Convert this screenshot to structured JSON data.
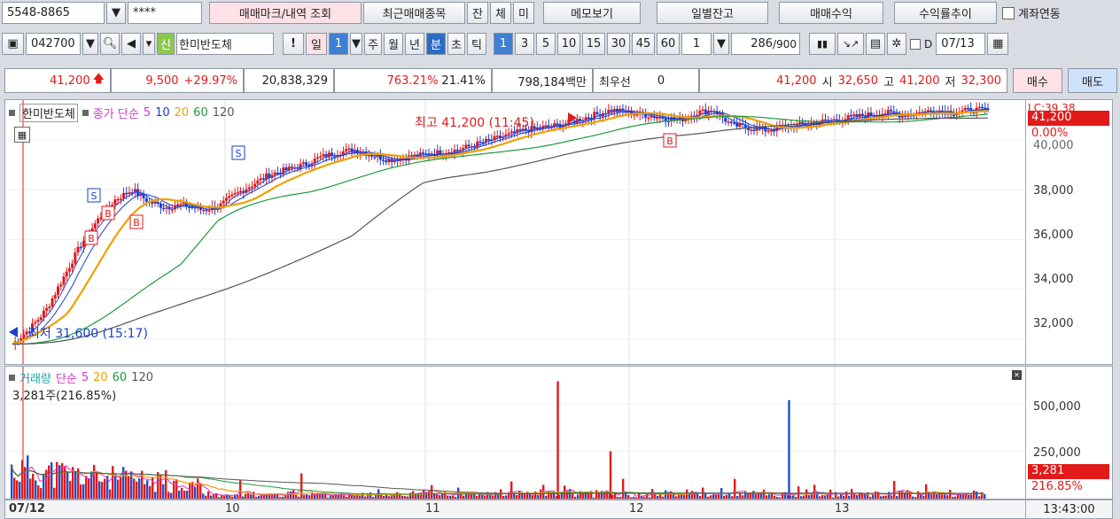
{
  "row1": {
    "account": "5548-8865",
    "password": "****",
    "buttons": [
      "매매마크/내역 조회",
      "최근매매종목",
      "잔",
      "체",
      "미",
      "메모보기",
      "일별잔고",
      "매매수익",
      "수익률추이"
    ],
    "link_label": "계좌연동"
  },
  "row2": {
    "code": "042700",
    "badge": "신",
    "stock_name": "한미반도체",
    "period_buttons": [
      "일",
      "1",
      "주",
      "월",
      "년",
      "분",
      "초",
      "틱"
    ],
    "interval_buttons": [
      "1",
      "3",
      "5",
      "10",
      "15",
      "30",
      "45",
      "60"
    ],
    "multiplier": "1",
    "count": "286",
    "count_max": "/900",
    "date_label": "D",
    "date": "07/13"
  },
  "quote": {
    "price": "41,200",
    "change": "9,500",
    "change_pct": "+29.97%",
    "volume": "20,838,329",
    "vol_ratio": "763.21%",
    "turnover": "21.41%",
    "amount": "798,184백만",
    "best_label": "최우선",
    "best_value": "0",
    "price2": "41,200",
    "open_label": "시",
    "open": "32,650",
    "high_label": "고",
    "high": "41,200",
    "low_label": "저",
    "low": "32,300",
    "buy_label": "매수",
    "sell_label": "매도"
  },
  "price_pane": {
    "legend_name": "한미반도체",
    "legend_series": "종가 단순",
    "ma": [
      "5",
      "10",
      "20",
      "60",
      "120"
    ],
    "high_note": "최고 41,200 (11:45)",
    "low_note": "최저 31,600 (15:17)",
    "current_price": "41,200",
    "current_pct": "0.00%",
    "lc_label": "LC:39.38",
    "marker_s": "S",
    "marker_b": "B"
  },
  "vol_pane": {
    "legend_name": "거래량",
    "legend_series": "단순",
    "ma": [
      "5",
      "20",
      "60",
      "120"
    ],
    "info": "3,281주(216.85%)",
    "current_vol": "3,281",
    "current_pct": "216.85%"
  },
  "time_axis": {
    "labels": [
      "07/12",
      "10",
      "11",
      "12",
      "13"
    ],
    "clock": "13:43:00"
  },
  "chart_data": {
    "type": "candlestick",
    "title": "",
    "xlabel": "",
    "ylabel": "",
    "ylim": [
      31000,
      41600
    ],
    "y_ticks": [
      "32,000",
      "34,000",
      "36,000",
      "38,000"
    ],
    "y_partial_tick": "40,000",
    "vol_ticks": [
      "500,000",
      "250,000"
    ],
    "x_labels": [
      "07/12",
      "10",
      "11",
      "12",
      "13"
    ],
    "close_path": [
      [
        0,
        31800
      ],
      [
        1,
        32400
      ],
      [
        2,
        33200
      ],
      [
        3,
        34500
      ],
      [
        4,
        35800
      ],
      [
        5,
        36800
      ],
      [
        6,
        37600
      ],
      [
        7,
        38000
      ],
      [
        8,
        37500
      ],
      [
        9,
        37300
      ],
      [
        10,
        37400
      ],
      [
        11,
        37200
      ],
      [
        12,
        37300
      ],
      [
        13,
        37800
      ],
      [
        14,
        38200
      ],
      [
        15,
        38600
      ],
      [
        16,
        38800
      ],
      [
        17,
        39000
      ],
      [
        18,
        39300
      ],
      [
        19,
        39500
      ],
      [
        20,
        39600
      ],
      [
        21,
        39400
      ],
      [
        22,
        39200
      ],
      [
        23,
        39300
      ],
      [
        24,
        39400
      ],
      [
        25,
        39500
      ],
      [
        26,
        39600
      ],
      [
        27,
        39800
      ],
      [
        28,
        40000
      ],
      [
        29,
        40200
      ],
      [
        30,
        40400
      ],
      [
        31,
        40500
      ],
      [
        32,
        40600
      ],
      [
        33,
        40800
      ],
      [
        34,
        41000
      ],
      [
        35,
        41200
      ],
      [
        36,
        41100
      ],
      [
        37,
        41000
      ],
      [
        38,
        40900
      ],
      [
        39,
        40800
      ],
      [
        40,
        41100
      ],
      [
        41,
        41200
      ],
      [
        42,
        40600
      ],
      [
        43,
        40500
      ],
      [
        44,
        40400
      ],
      [
        45,
        40500
      ],
      [
        46,
        40600
      ],
      [
        47,
        40700
      ],
      [
        48,
        40800
      ],
      [
        49,
        40900
      ],
      [
        50,
        41000
      ],
      [
        51,
        41100
      ],
      [
        52,
        41000
      ],
      [
        53,
        41100
      ],
      [
        54,
        41200
      ],
      [
        55,
        41100
      ],
      [
        56,
        41200
      ],
      [
        57,
        41200
      ]
    ],
    "series": [
      {
        "name": "5",
        "color": "#2a48d6"
      },
      {
        "name": "10",
        "color": "#1a3fcc"
      },
      {
        "name": "20",
        "color": "#f0a000"
      },
      {
        "name": "60",
        "color": "#1f9a3a"
      },
      {
        "name": "120",
        "color": "#555555"
      }
    ],
    "volume_spikes": [
      {
        "x_frac": 0.558,
        "value": 620000
      },
      {
        "x_frac": 0.612,
        "value": 250000
      },
      {
        "x_frac": 0.795,
        "value": 520000
      }
    ]
  }
}
